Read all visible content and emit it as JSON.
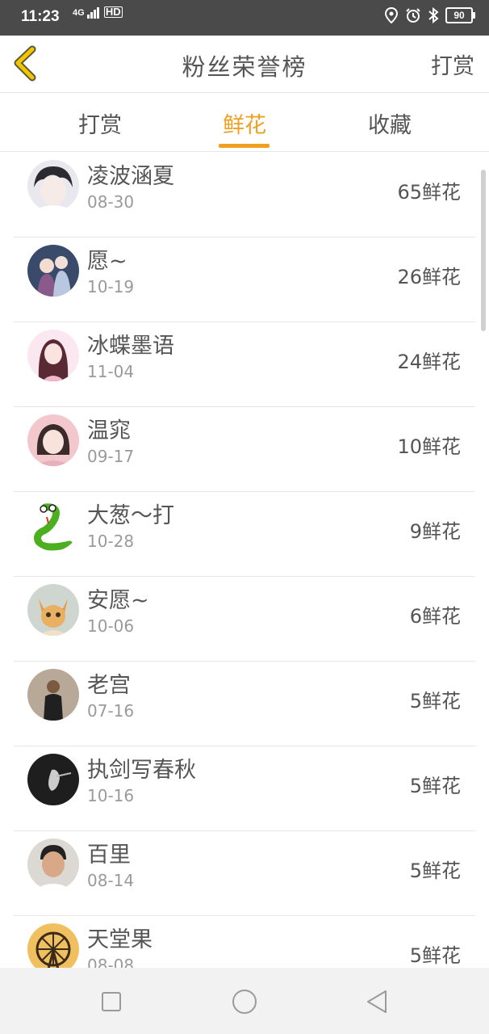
{
  "status_bar": {
    "time": "11:23",
    "network": "4G",
    "hd": "HD",
    "battery": "90"
  },
  "header": {
    "title": "粉丝荣誉榜",
    "action": "打赏"
  },
  "tabs": [
    {
      "label": "打赏",
      "active": false
    },
    {
      "label": "鲜花",
      "active": true
    },
    {
      "label": "收藏",
      "active": false
    }
  ],
  "list": [
    {
      "name": "凌波涵夏",
      "date": "08-30",
      "count": "65鲜花"
    },
    {
      "name": "愿~",
      "date": "10-19",
      "count": "26鲜花"
    },
    {
      "name": "冰蝶墨语",
      "date": "11-04",
      "count": "24鲜花"
    },
    {
      "name": "温窕",
      "date": "09-17",
      "count": "10鲜花"
    },
    {
      "name": "大葱〜打",
      "date": "10-28",
      "count": "9鲜花"
    },
    {
      "name": "安愿~",
      "date": "10-06",
      "count": "6鲜花"
    },
    {
      "name": "老宫",
      "date": "07-16",
      "count": "5鲜花"
    },
    {
      "name": "执剑写春秋",
      "date": "10-16",
      "count": "5鲜花"
    },
    {
      "name": "百里",
      "date": "08-14",
      "count": "5鲜花"
    },
    {
      "name": "天堂果",
      "date": "08-08",
      "count": "5鲜花"
    }
  ],
  "colors": {
    "accent": "#f0a020",
    "back_icon": "#f5c400",
    "status_bar": "#4a4a4a",
    "divider": "#e6e6e6"
  },
  "icons": {
    "back": "chevron-left-icon",
    "location": "location-icon",
    "alarm": "alarm-icon",
    "bluetooth": "bluetooth-icon",
    "nav_recent": "square-icon",
    "nav_home": "circle-icon",
    "nav_back": "triangle-back-icon"
  }
}
